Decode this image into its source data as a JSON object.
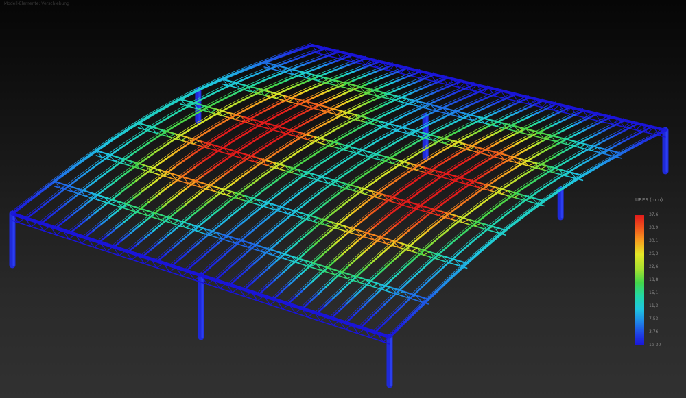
{
  "window": {
    "title": "Modell-Elemente: Verschiebung"
  },
  "legend": {
    "title": "URES (mm)",
    "ticks": [
      "37,6",
      "33,9",
      "30,1",
      "26,3",
      "22,6",
      "18,8",
      "15,1",
      "11,3",
      "7,53",
      "3,76",
      "1e-30"
    ],
    "colormap": [
      "#1a14d8",
      "#1f3ee4",
      "#1f86e8",
      "#1fc7e0",
      "#22d8a6",
      "#43d64a",
      "#a2e031",
      "#e4e626",
      "#f7a01f",
      "#f0561c",
      "#e21b1b"
    ]
  },
  "model": {
    "type": "roof-truss-frame",
    "longitudinal_beam_count": 27,
    "truss_line_count": 8,
    "column_count": 7
  }
}
